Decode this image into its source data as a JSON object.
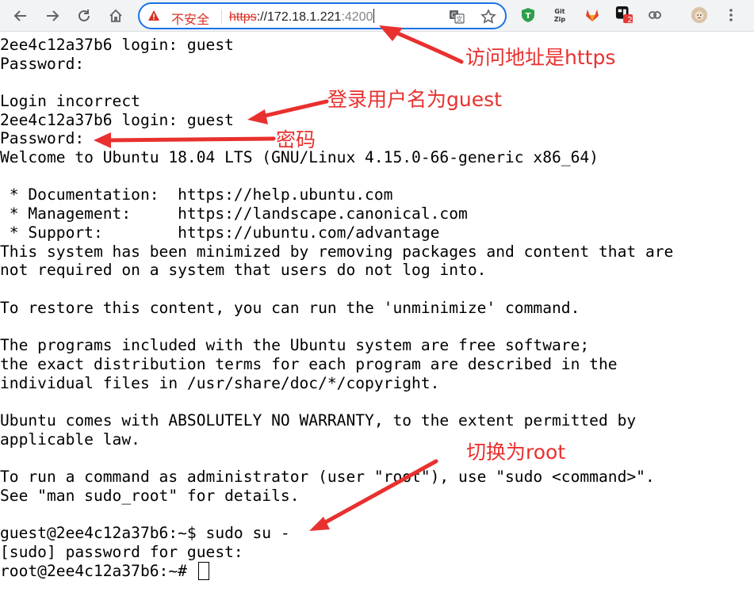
{
  "browser": {
    "security_label": "不安全",
    "url_scheme": "https",
    "url_rest": "://172.18.1.221",
    "url_port": ":4200",
    "ext_badge": "2",
    "icons": [
      "back-icon",
      "forward-icon",
      "reload-icon",
      "home-icon",
      "warning-icon",
      "translate-icon",
      "star-icon",
      "adguard-icon",
      "gitzip-icon",
      "gitlab-icon",
      "extension-badge-icon",
      "link-icon",
      "profile-avatar-icon",
      "menu-icon"
    ]
  },
  "colors": {
    "annotation": "#e8312f",
    "address_focus": "#1a73e8",
    "insecure": "#d93025"
  },
  "terminal": {
    "lines": [
      "2ee4c12a37b6 login: guest",
      "Password:",
      "",
      "Login incorrect",
      "2ee4c12a37b6 login: guest",
      "Password:",
      "Welcome to Ubuntu 18.04 LTS (GNU/Linux 4.15.0-66-generic x86_64)",
      "",
      " * Documentation:  https://help.ubuntu.com",
      " * Management:     https://landscape.canonical.com",
      " * Support:        https://ubuntu.com/advantage",
      "This system has been minimized by removing packages and content that are",
      "not required on a system that users do not log into.",
      "",
      "To restore this content, you can run the 'unminimize' command.",
      "",
      "The programs included with the Ubuntu system are free software;",
      "the exact distribution terms for each program are described in the",
      "individual files in /usr/share/doc/*/copyright.",
      "",
      "Ubuntu comes with ABSOLUTELY NO WARRANTY, to the extent permitted by",
      "applicable law.",
      "",
      "To run a command as administrator (user \"root\"), use \"sudo <command>\".",
      "See \"man sudo_root\" for details.",
      "",
      "guest@2ee4c12a37b6:~$ sudo su -",
      "[sudo] password for guest:",
      "root@2ee4c12a37b6:~# "
    ]
  },
  "annotations": {
    "https": "访问地址是https",
    "username": "登录用户名为guest",
    "password": "密码",
    "root": "切换为root"
  }
}
